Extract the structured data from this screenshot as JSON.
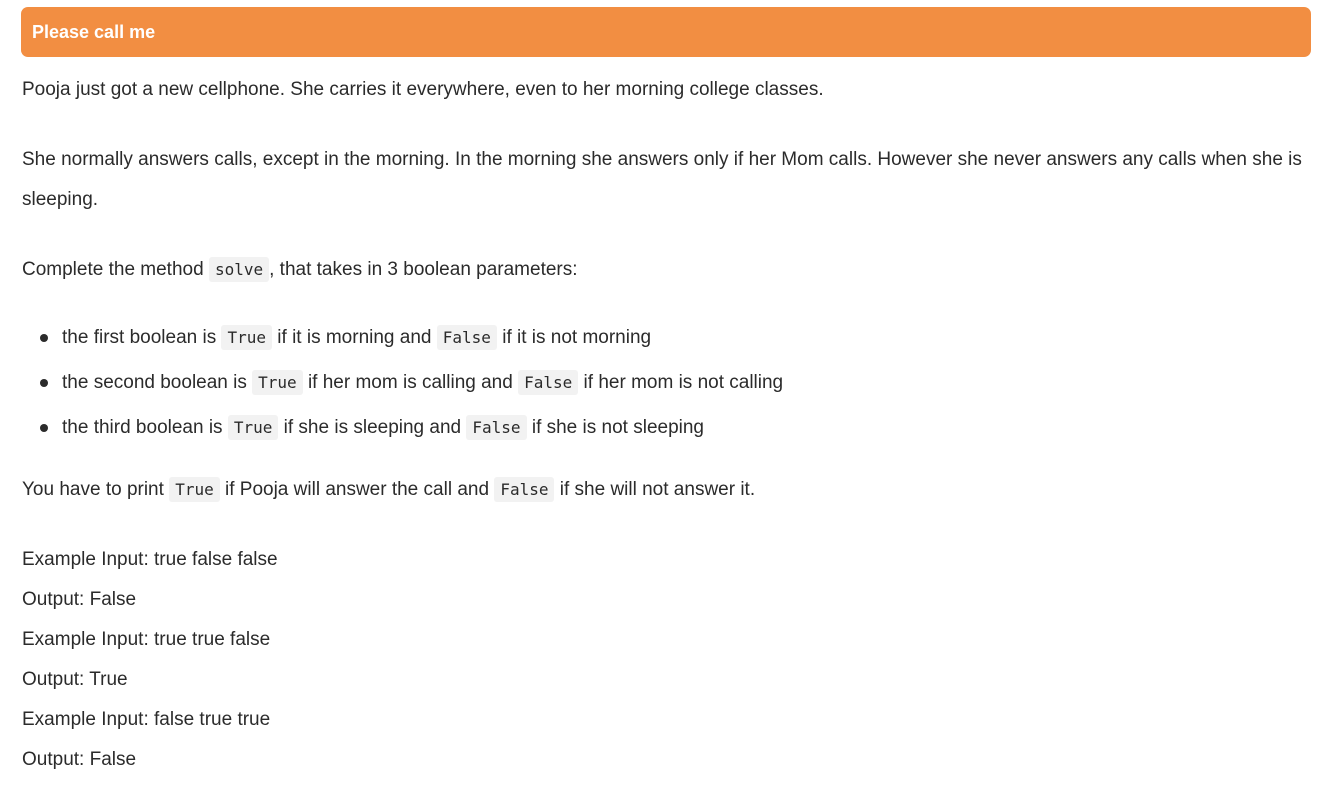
{
  "header": {
    "title": "Please call me",
    "bg_color": "#f28e42"
  },
  "intro": "Pooja just got a new cellphone. She carries it everywhere, even to her morning college classes.",
  "normal": "She normally answers calls, except in the morning. In the morning she answers only if her Mom calls. However she never answers any calls when she is sleeping.",
  "method": {
    "prefix": "Complete the method ",
    "code": "solve",
    "suffix": ", that takes in 3 boolean parameters:"
  },
  "rules": [
    {
      "text1": "the first boolean is ",
      "code1": "True",
      "text2": " if it is morning and ",
      "code2": "False",
      "text3": " if it is not morning"
    },
    {
      "text1": "the second boolean is ",
      "code1": "True",
      "text2": " if her mom is calling and ",
      "code2": "False",
      "text3": " if her mom is not calling"
    },
    {
      "text1": "the third boolean is ",
      "code1": "True",
      "text2": " if she is sleeping and ",
      "code2": "False",
      "text3": " if she is not sleeping"
    }
  ],
  "print_line": {
    "text1": "You have to print ",
    "code1": "True",
    "text2": " if Pooja will answer the call and ",
    "code2": "False",
    "text3": " if she will not answer it."
  },
  "examples": [
    "Example Input: true false false",
    "Output: False",
    "Example Input: true true false",
    "Output: True",
    "Example Input: false true true",
    "Output: False"
  ]
}
